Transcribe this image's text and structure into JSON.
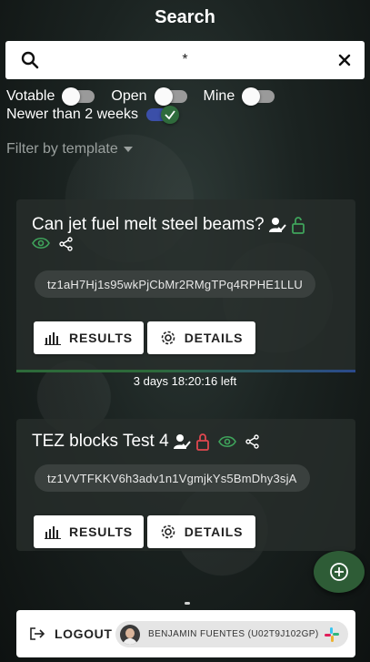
{
  "header": {
    "title": "Search"
  },
  "search": {
    "value": "*",
    "icon": "search-icon",
    "clear_icon": "close-icon"
  },
  "filters": {
    "toggles": [
      {
        "label": "Votable",
        "on": false
      },
      {
        "label": "Open",
        "on": false
      },
      {
        "label": "Mine",
        "on": false
      }
    ],
    "newer": {
      "label": "Newer than 2 weeks",
      "on": true
    },
    "template_label": "Filter by template"
  },
  "cards": [
    {
      "title": "Can jet fuel melt steel beams?",
      "address": "tz1aH7Hj1s95wkPjCbMr2RMgTPq4RPHE1LLU",
      "lock_state": "unlocked",
      "lock_color": "#3fa35b",
      "results_label": "RESULTS",
      "details_label": "DETAILS",
      "time_left": "3 days 18:20:16 left"
    },
    {
      "title": "TEZ blocks Test 4",
      "address": "tz1VVTFKKV6h3adv1n1VgmjkYs5BmDhy3sjA",
      "lock_state": "locked",
      "lock_color": "#e0474f",
      "results_label": "RESULTS",
      "details_label": "DETAILS"
    }
  ],
  "footer": {
    "logout_label": "LOGOUT",
    "user_name": "BENJAMIN FUENTES (U02T9J102GP)"
  },
  "colors": {
    "accent_green": "#2e5c36",
    "eye_green": "#3fa35b"
  }
}
